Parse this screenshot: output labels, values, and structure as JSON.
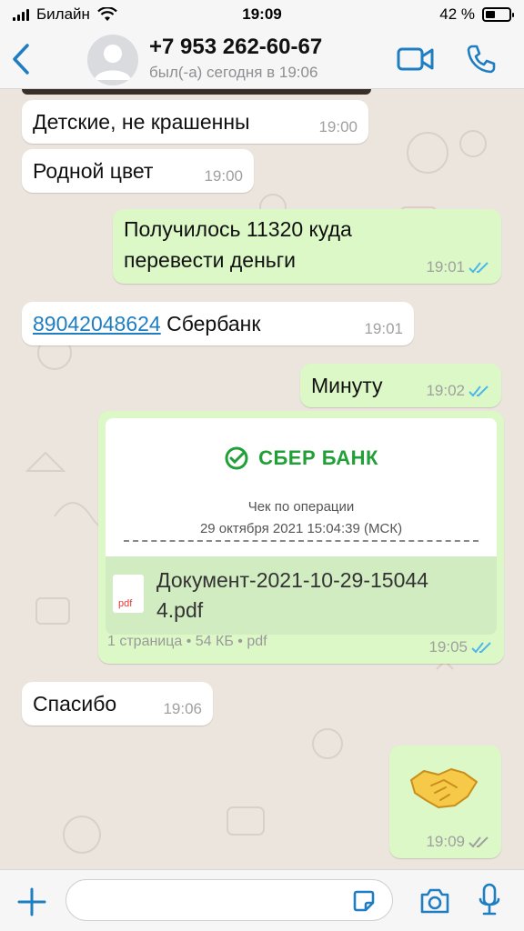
{
  "status_bar": {
    "carrier": "Билайн",
    "time": "19:09",
    "battery": "42 %",
    "battery_level": 0.42
  },
  "header": {
    "contact": "+7 953 262-60-67",
    "last_seen": "был(-а) сегодня в 19:06"
  },
  "messages": [
    {
      "text": "Детские, не крашенны",
      "time": "19:00"
    },
    {
      "text": "Родной цвет",
      "time": "19:00"
    },
    {
      "text_line1": "Получилось 11320 куда",
      "text_line2": "перевести деньги",
      "time": "19:01"
    },
    {
      "link": "89042048624",
      "text": "Сбербанк",
      "time": "19:01"
    },
    {
      "text": "Минуту",
      "time": "19:02"
    },
    {
      "bank": "СБЕР БАНК",
      "receipt_title": "Чек по операции",
      "receipt_date": "29 октября 2021 15:04:39 (МСК)",
      "file_icon": "pdf",
      "file_line1": "Документ-2021-10-29-15044",
      "file_line2": "4.pdf",
      "meta": "1 страница • 54 КБ • pdf",
      "time": "19:05"
    },
    {
      "text": "Спасибо",
      "time": "19:06"
    },
    {
      "emoji": "handshake-icon",
      "time": "19:09"
    }
  ],
  "colors": {
    "incoming": "#ffffff",
    "outgoing": "#dcf8c6",
    "accent": "#1f7ec2",
    "read_ticks": "#4fb6ec",
    "sent_ticks": "#a0a0a0",
    "sber": "#21a038"
  },
  "input": {
    "placeholder": ""
  }
}
